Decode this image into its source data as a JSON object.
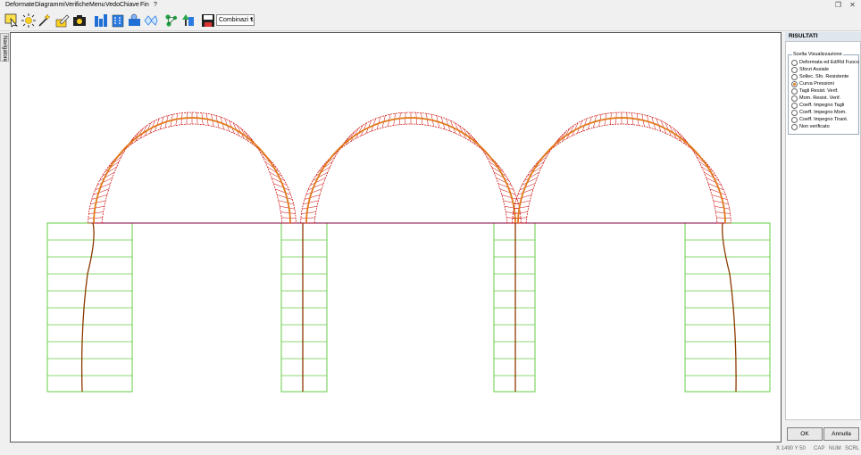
{
  "menu": [
    "Deformate",
    "Diagrammi",
    "Verifiche",
    "Menu",
    "VedoChiave",
    "Fin",
    "?"
  ],
  "window_controls": {
    "restore": "❐",
    "close": "✕"
  },
  "toolbar": {
    "icons": [
      "pointer-icon",
      "sun-icon",
      "wand-icon",
      "edit-icon",
      "camera-icon",
      "columns-icon",
      "building-icon",
      "load-icon",
      "wave-icon",
      "molecule-icon",
      "tree-icon",
      "save-icon"
    ],
    "combo_value": "Combinazi 1"
  },
  "left_tab": "Navigatore",
  "colors": {
    "accent": "#e07b1a",
    "wall": "#66cc44",
    "beam": "#800040",
    "deformed": "#8b3a00",
    "diagram": "#cc0000"
  },
  "panel": {
    "title": "RISULTATI",
    "group_title": "Scelta Visualizzazione",
    "options": [
      {
        "label": "Deformata ed Ed/Rd Fuoco",
        "selected": false
      },
      {
        "label": "Sforzi Assiale",
        "selected": false
      },
      {
        "label": "Sollec. Sfo. Resistente",
        "selected": false
      },
      {
        "label": "Curva Pressioni",
        "selected": true
      },
      {
        "label": "Tagli Resist. Verif.",
        "selected": false
      },
      {
        "label": "Mom. Resist. Verif.",
        "selected": false
      },
      {
        "label": "Coeff. Impegno Tagli",
        "selected": false
      },
      {
        "label": "Coeff. Impegno Mom.",
        "selected": false
      },
      {
        "label": "Coeff. Impegno Tirant.",
        "selected": false
      },
      {
        "label": "Non verificato",
        "selected": false
      }
    ],
    "ok": "OK",
    "cancel": "Annulla"
  },
  "status": {
    "coords": "X 1490 Y  50",
    "cap": "CAP",
    "num": "NUM",
    "scrl": "SCRL"
  }
}
